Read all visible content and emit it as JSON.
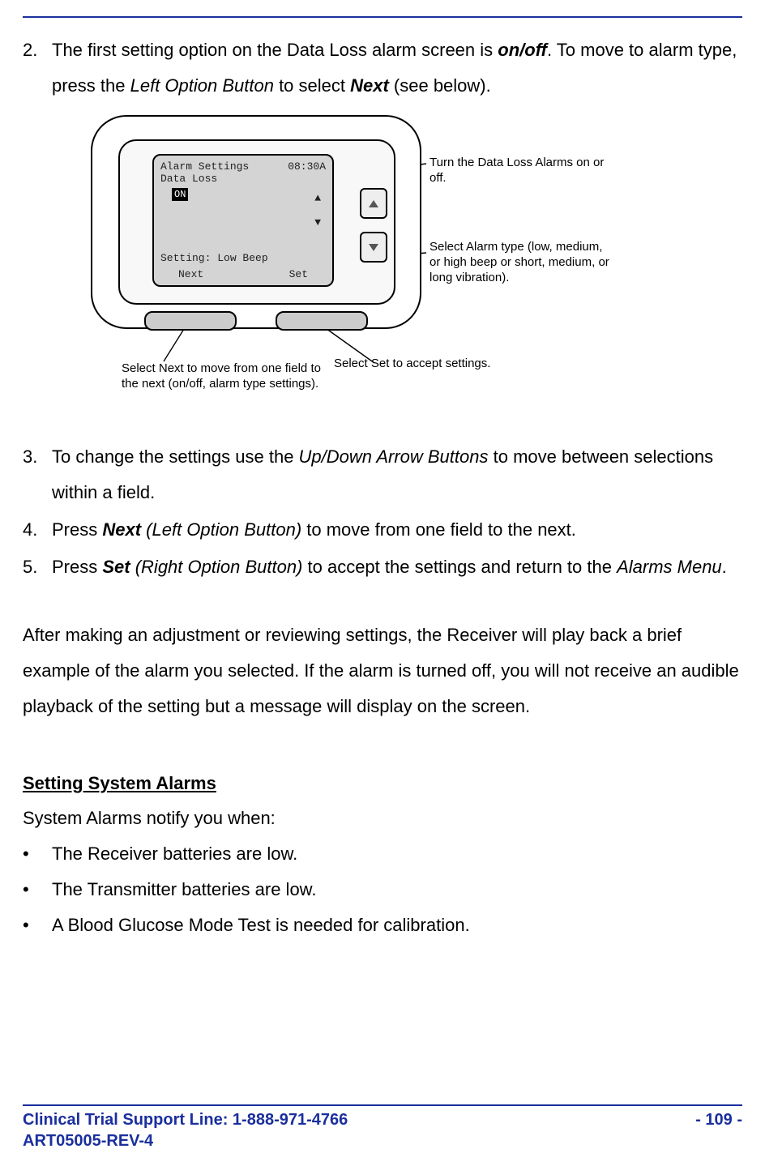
{
  "steps": {
    "s2_num": "2.",
    "s2_a": "The first setting option on the Data Loss alarm screen is ",
    "s2_b": "on/off",
    "s2_c": ".  To move to alarm type, press the ",
    "s2_d": "Left Option Button",
    "s2_e": " to select ",
    "s2_f": "Next",
    "s2_g": " (see below).",
    "s3_num": "3.",
    "s3_a": "To change the settings use the ",
    "s3_b": "Up/Down Arrow Buttons",
    "s3_c": " to move between selections within a field.",
    "s4_num": "4.",
    "s4_a": "Press ",
    "s4_b": "Next",
    "s4_c": " (Left Option Button)",
    "s4_d": " to move from one field to the next.",
    "s5_num": "5.",
    "s5_a": "Press ",
    "s5_b": "Set",
    "s5_c": " (Right Option Button)",
    "s5_d": " to accept the settings and return to the ",
    "s5_e": "Alarms Menu",
    "s5_f": "."
  },
  "figure": {
    "lcd_title": "Alarm Settings",
    "lcd_time": "08:30A",
    "lcd_line2": "Data Loss",
    "lcd_on": "ON",
    "lcd_setting": "Setting: Low Beep",
    "lcd_next": "Next",
    "lcd_set": "Set",
    "callout_top": "Turn the Data Loss Alarms on or off.",
    "callout_mid": "Select Alarm type (low, medium, or high beep or short, medium, or long vibration).",
    "callout_set": "Select Set to accept settings.",
    "callout_next": "Select Next to move from one field to the next (on/off, alarm type settings)."
  },
  "para1": "After making an adjustment or reviewing settings, the Receiver will play back a brief example of the alarm you selected. If the alarm is turned off, you will not receive an audible playback of the setting but a message will display on the screen.",
  "section_heading": "Setting System Alarms",
  "section_intro": "System Alarms notify you when:",
  "bullets": {
    "b1": "The Receiver batteries are low.",
    "b2": "The Transmitter batteries are low.",
    "b3": "A Blood Glucose Mode Test is needed for calibration."
  },
  "footer": {
    "left1": "Clinical Trial Support Line:  1-888-971-4766",
    "left2": "ART05005-REV-4",
    "right": "- 109 -"
  }
}
